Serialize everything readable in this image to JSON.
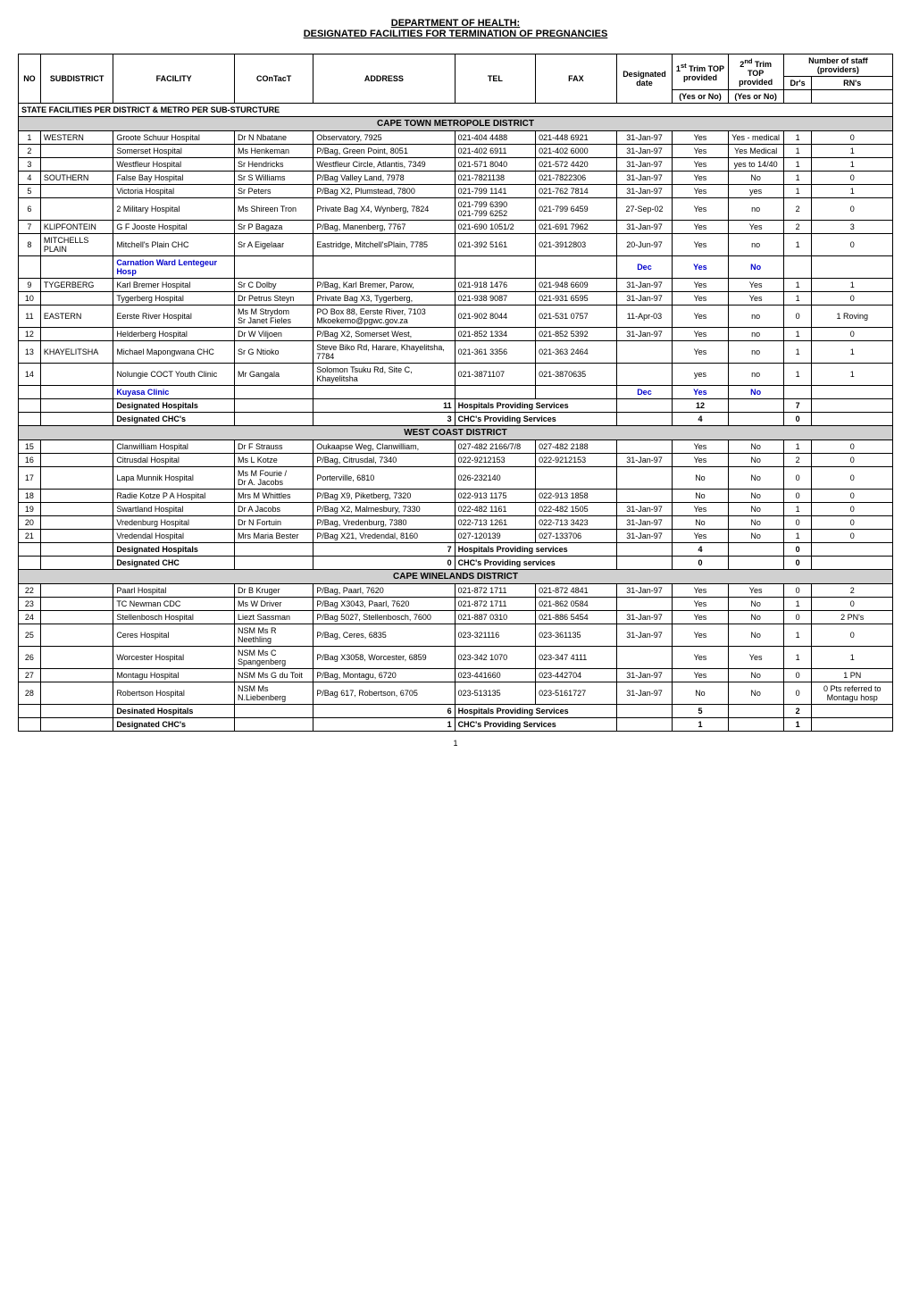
{
  "title": {
    "line1": "DEPARTMENT OF HEALTH:",
    "line2": "DESIGNATED FACILITIES FOR TERMINATION OF PREGNANCIES"
  },
  "table": {
    "headers": {
      "no": "NO",
      "subdistrict": "SUBDISTRICT",
      "facility": "FACILITY",
      "contact": "COnTacT",
      "address": "ADDRESS",
      "tel": "TEL",
      "fax": "FAX",
      "designated_date": "Designated date",
      "trim1_top": "1st Trim TOP provided",
      "trim2_top": "2nd Trim TOP provided",
      "yes_or_no1": "(Yes or No)",
      "yes_or_no2": "(Yes or No)",
      "staff_header": "Number of staff (providers)",
      "drs": "Dr's",
      "rns": "RN's"
    },
    "state_header": "STATE FACILITIES PER DISTRICT & METRO PER SUB-STURCTURE",
    "sections": [
      {
        "name": "CAPE TOWN METROPOLE DISTRICT",
        "rows": [
          {
            "no": "1",
            "subdistrict": "WESTERN",
            "facility": "Groote Schuur Hospital",
            "contact": "Dr N Nbatane",
            "address": "Observatory, 7925",
            "tel": "021-404 4488",
            "fax": "021-448 6921",
            "date": "31-Jan-97",
            "trim1": "Yes",
            "trim2": "Yes - medical",
            "drs": "1",
            "rns": "0"
          },
          {
            "no": "2",
            "subdistrict": "",
            "facility": "Somerset Hospital",
            "contact": "Ms Henkeman",
            "address": "P/Bag, Green Point, 8051",
            "tel": "021-402 6911",
            "fax": "021-402 6000",
            "date": "31-Jan-97",
            "trim1": "Yes",
            "trim2": "Yes Medical",
            "drs": "1",
            "rns": "1"
          },
          {
            "no": "3",
            "subdistrict": "",
            "facility": "Westfleur Hospital",
            "contact": "Sr Hendricks",
            "address": "Westfleur Circle, Atlantis, 7349",
            "tel": "021-571 8040",
            "fax": "021-572 4420",
            "date": "31-Jan-97",
            "trim1": "Yes",
            "trim2": "yes to 14/40",
            "drs": "1",
            "rns": "1"
          },
          {
            "no": "4",
            "subdistrict": "SOUTHERN",
            "facility": "False Bay Hospital",
            "contact": "Sr S Williams",
            "address": "P/Bag Valley Land, 7978",
            "tel": "021-7821138",
            "fax": "021-7822306",
            "date": "31-Jan-97",
            "trim1": "Yes",
            "trim2": "No",
            "drs": "1",
            "rns": "0"
          },
          {
            "no": "5",
            "subdistrict": "",
            "facility": "Victoria Hospital",
            "contact": "Sr Peters",
            "address": "P/Bag X2, Plumstead, 7800",
            "tel": "021-799 1141",
            "fax": "021-762 7814",
            "date": "31-Jan-97",
            "trim1": "Yes",
            "trim2": "yes",
            "drs": "1",
            "rns": "1"
          },
          {
            "no": "6",
            "subdistrict": "",
            "facility": "2 Military Hospital",
            "contact": "Ms Shireen Tron",
            "address": "Private Bag X4, Wynberg, 7824",
            "tel": "021-799 6390\n021-799 6252",
            "fax": "021-799 6459",
            "date": "27-Sep-02",
            "trim1": "Yes",
            "trim2": "no",
            "drs": "2",
            "rns": "0"
          },
          {
            "no": "7",
            "subdistrict": "KLIPFONTEIN",
            "facility": "G F Jooste Hospital",
            "contact": "Sr P Bagaza",
            "address": "P/Bag, Manenberg, 7767",
            "tel": "021-690 1051/2",
            "fax": "021-691 7962",
            "date": "31-Jan-97",
            "trim1": "Yes",
            "trim2": "Yes",
            "drs": "2",
            "rns": "3"
          },
          {
            "no": "8",
            "subdistrict": "MITCHELLS PLAIN",
            "facility": "Mitchell's Plain CHC",
            "contact": "Sr A Eigelaar",
            "address": "Eastridge, Mitchell'sPlain, 7785",
            "tel": "021-392 5161",
            "fax": "021-3912803",
            "date": "20-Jun-97",
            "trim1": "Yes",
            "trim2": "no",
            "drs": "1",
            "rns": "0"
          },
          {
            "no": "",
            "subdistrict": "",
            "facility": "Carnation Ward Lentegeur Hosp",
            "contact": "",
            "address": "",
            "tel": "",
            "fax": "",
            "date": "Dec",
            "trim1": "Yes",
            "trim2": "No",
            "drs": "",
            "rns": "",
            "highlight": true
          },
          {
            "no": "9",
            "subdistrict": "TYGERBERG",
            "facility": "Karl Bremer Hospital",
            "contact": "Sr C Dolby",
            "address": "P/Bag, Karl Bremer, Parow,",
            "tel": "021-918 1476",
            "fax": "021-948 6609",
            "date": "31-Jan-97",
            "trim1": "Yes",
            "trim2": "Yes",
            "drs": "1",
            "rns": "1"
          },
          {
            "no": "10",
            "subdistrict": "",
            "facility": "Tygerberg Hospital",
            "contact": "Dr Petrus Steyn",
            "address": "Private Bag X3, Tygerberg,",
            "tel": "021-938 9087",
            "fax": "021-931 6595",
            "date": "31-Jan-97",
            "trim1": "Yes",
            "trim2": "Yes",
            "drs": "1",
            "rns": "0"
          },
          {
            "no": "11",
            "subdistrict": "EASTERN",
            "facility": "Eerste River Hospital",
            "contact": "Ms M Strydom\nSr Janet Fieles",
            "address": "PO Box 88, Eerste River, 7103\nMkoekemo@pgwc.gov.za",
            "tel": "021-902 8044",
            "fax": "021-531 0757",
            "date": "11-Apr-03",
            "trim1": "Yes",
            "trim2": "no",
            "drs": "0",
            "rns": "1 Roving"
          },
          {
            "no": "12",
            "subdistrict": "",
            "facility": "Helderberg Hospital",
            "contact": "Dr W Viljoen",
            "address": "P/Bag X2, Somerset West,",
            "tel": "021-852 1334",
            "fax": "021-852 5392",
            "date": "31-Jan-97",
            "trim1": "Yes",
            "trim2": "no",
            "drs": "1",
            "rns": "0"
          },
          {
            "no": "13",
            "subdistrict": "KHAYELITSHA",
            "facility": "Michael Mapongwana CHC",
            "contact": "Sr G Ntioko",
            "address": "Steve Biko Rd, Harare, Khayelitsha, 7784",
            "tel": "021-361 3356",
            "fax": "021-363 2464",
            "date": "",
            "trim1": "Yes",
            "trim2": "no",
            "drs": "1",
            "rns": "1"
          },
          {
            "no": "14",
            "subdistrict": "",
            "facility": "Nolungie COCT Youth Clinic",
            "contact": "Mr Gangala",
            "address": "Solomon Tsuku Rd, Site C, Khayelitsha",
            "tel": "021-3871107",
            "fax": "021-3870635",
            "date": "",
            "trim1": "yes",
            "trim2": "no",
            "drs": "1",
            "rns": "1"
          },
          {
            "no": "",
            "subdistrict": "",
            "facility": "Kuyasa Clinic",
            "contact": "",
            "address": "",
            "tel": "",
            "fax": "",
            "date": "Dec",
            "trim1": "Yes",
            "trim2": "No",
            "drs": "",
            "rns": "",
            "highlight": true
          }
        ],
        "summaries": [
          {
            "label": "Designated Hospitals",
            "count1": "11",
            "label2": "Hospitals Providing Services",
            "count2": "12",
            "count3": "7"
          },
          {
            "label": "Designated CHC's",
            "count1": "3",
            "label2": "CHC's Providing Services",
            "count2": "4",
            "count3": "0"
          }
        ]
      },
      {
        "name": "WEST COAST DISTRICT",
        "rows": [
          {
            "no": "15",
            "subdistrict": "",
            "facility": "Clanwilliam Hospital",
            "contact": "Dr F Strauss",
            "address": "Oukaapse Weg, Clanwilliam,",
            "tel": "027-482 2166/7/8",
            "fax": "027-482 2188",
            "date": "",
            "trim1": "Yes",
            "trim2": "No",
            "drs": "1",
            "rns": "0"
          },
          {
            "no": "16",
            "subdistrict": "",
            "facility": "Citrusdal Hospital",
            "contact": "Ms L Kotze",
            "address": "P/Bag, Citrusdal, 7340",
            "tel": "022-9212153",
            "fax": "022-9212153",
            "date": "31-Jan-97",
            "trim1": "Yes",
            "trim2": "No",
            "drs": "2",
            "rns": "0"
          },
          {
            "no": "17",
            "subdistrict": "",
            "facility": "Lapa Munnik Hospital",
            "contact": "Ms M Fourie /\nDr A. Jacobs",
            "address": "Porterville, 6810",
            "tel": "026-232140",
            "fax": "",
            "date": "",
            "trim1": "No",
            "trim2": "No",
            "drs": "0",
            "rns": "0"
          },
          {
            "no": "18",
            "subdistrict": "",
            "facility": "Radie Kotze P A Hospital",
            "contact": "Mrs M Whittles",
            "address": "P/Bag X9, Piketberg, 7320",
            "tel": "022-913 1175",
            "fax": "022-913 1858",
            "date": "",
            "trim1": "No",
            "trim2": "No",
            "drs": "0",
            "rns": "0"
          },
          {
            "no": "19",
            "subdistrict": "",
            "facility": "Swartland Hospital",
            "contact": "Dr A Jacobs",
            "address": "P/Bag X2, Malmesbury, 7330",
            "tel": "022-482 1161",
            "fax": "022-482 1505",
            "date": "31-Jan-97",
            "trim1": "Yes",
            "trim2": "No",
            "drs": "1",
            "rns": "0"
          },
          {
            "no": "20",
            "subdistrict": "",
            "facility": "Vredenburg Hospital",
            "contact": "Dr N Fortuin",
            "address": "P/Bag, Vredenburg, 7380",
            "tel": "022-713 1261",
            "fax": "022-713 3423",
            "date": "31-Jan-97",
            "trim1": "No",
            "trim2": "No",
            "drs": "0",
            "rns": "0"
          },
          {
            "no": "21",
            "subdistrict": "",
            "facility": "Vredendal Hospital",
            "contact": "Mrs Maria Bester",
            "address": "P/Bag X21, Vredendal, 8160",
            "tel": "027-120139",
            "fax": "027-133706",
            "date": "31-Jan-97",
            "trim1": "Yes",
            "trim2": "No",
            "drs": "1",
            "rns": "0"
          }
        ],
        "summaries": [
          {
            "label": "Designated Hospitals",
            "count1": "7",
            "label2": "Hospitals Providing services",
            "count2": "4",
            "count3": "0"
          },
          {
            "label": "Designated CHC",
            "count1": "0",
            "label2": "CHC's Providing services",
            "count2": "0",
            "count3": "0"
          }
        ]
      },
      {
        "name": "CAPE WINELANDS DISTRICT",
        "rows": [
          {
            "no": "22",
            "subdistrict": "",
            "facility": "Paarl Hospital",
            "contact": "Dr B Kruger",
            "address": "P/Bag, Paarl, 7620",
            "tel": "021-872 1711",
            "fax": "021-872 4841",
            "date": "31-Jan-97",
            "trim1": "Yes",
            "trim2": "Yes",
            "drs": "0",
            "rns": "2"
          },
          {
            "no": "23",
            "subdistrict": "",
            "facility": "TC Newman CDC",
            "contact": "Ms W Driver",
            "address": "P/Bag X3043, Paarl, 7620",
            "tel": "021-872 1711",
            "fax": "021-862 0584",
            "date": "",
            "trim1": "Yes",
            "trim2": "No",
            "drs": "1",
            "rns": "0"
          },
          {
            "no": "24",
            "subdistrict": "",
            "facility": "Stellenbosch Hospital",
            "contact": "Liezt Sassman",
            "address": "P/Bag 5027, Stellenbosch, 7600",
            "tel": "021-887 0310",
            "fax": "021-886 5454",
            "date": "31-Jan-97",
            "trim1": "Yes",
            "trim2": "No",
            "drs": "0",
            "rns": "2 PN's"
          },
          {
            "no": "25",
            "subdistrict": "",
            "facility": "Ceres Hospital",
            "contact": "NSM Ms R Neethling",
            "address": "P/Bag, Ceres, 6835",
            "tel": "023-321116",
            "fax": "023-361135",
            "date": "31-Jan-97",
            "trim1": "Yes",
            "trim2": "No",
            "drs": "1",
            "rns": "0"
          },
          {
            "no": "26",
            "subdistrict": "",
            "facility": "Worcester Hospital",
            "contact": "NSM Ms C Spangenberg",
            "address": "P/Bag X3058, Worcester, 6859",
            "tel": "023-342 1070",
            "fax": "023-347 4111",
            "date": "",
            "trim1": "Yes",
            "trim2": "Yes",
            "drs": "1",
            "rns": "1"
          },
          {
            "no": "27",
            "subdistrict": "",
            "facility": "Montagu Hospital",
            "contact": "NSM Ms G du Toit",
            "address": "P/Bag, Montagu, 6720",
            "tel": "023-441660",
            "fax": "023-442704",
            "date": "31-Jan-97",
            "trim1": "Yes",
            "trim2": "No",
            "drs": "0",
            "rns": "1 PN"
          },
          {
            "no": "28",
            "subdistrict": "",
            "facility": "Robertson Hospital",
            "contact": "NSM Ms N.Liebenberg",
            "address": "P/Bag 617, Robertson, 6705",
            "tel": "023-513135",
            "fax": "023-5161727",
            "date": "31-Jan-97",
            "trim1": "No",
            "trim2": "No",
            "drs": "0",
            "rns": "0 Pts referred to Montagu hosp"
          }
        ],
        "summaries": [
          {
            "label": "Desinated Hospitals",
            "count1": "6",
            "label2": "Hospitals Providing Services",
            "count2": "5",
            "count3": "2"
          },
          {
            "label": "Designated CHC's",
            "count1": "1",
            "label2": "CHC's Providing Services",
            "count2": "1",
            "count3": "1"
          }
        ]
      }
    ]
  },
  "page_number": "1"
}
